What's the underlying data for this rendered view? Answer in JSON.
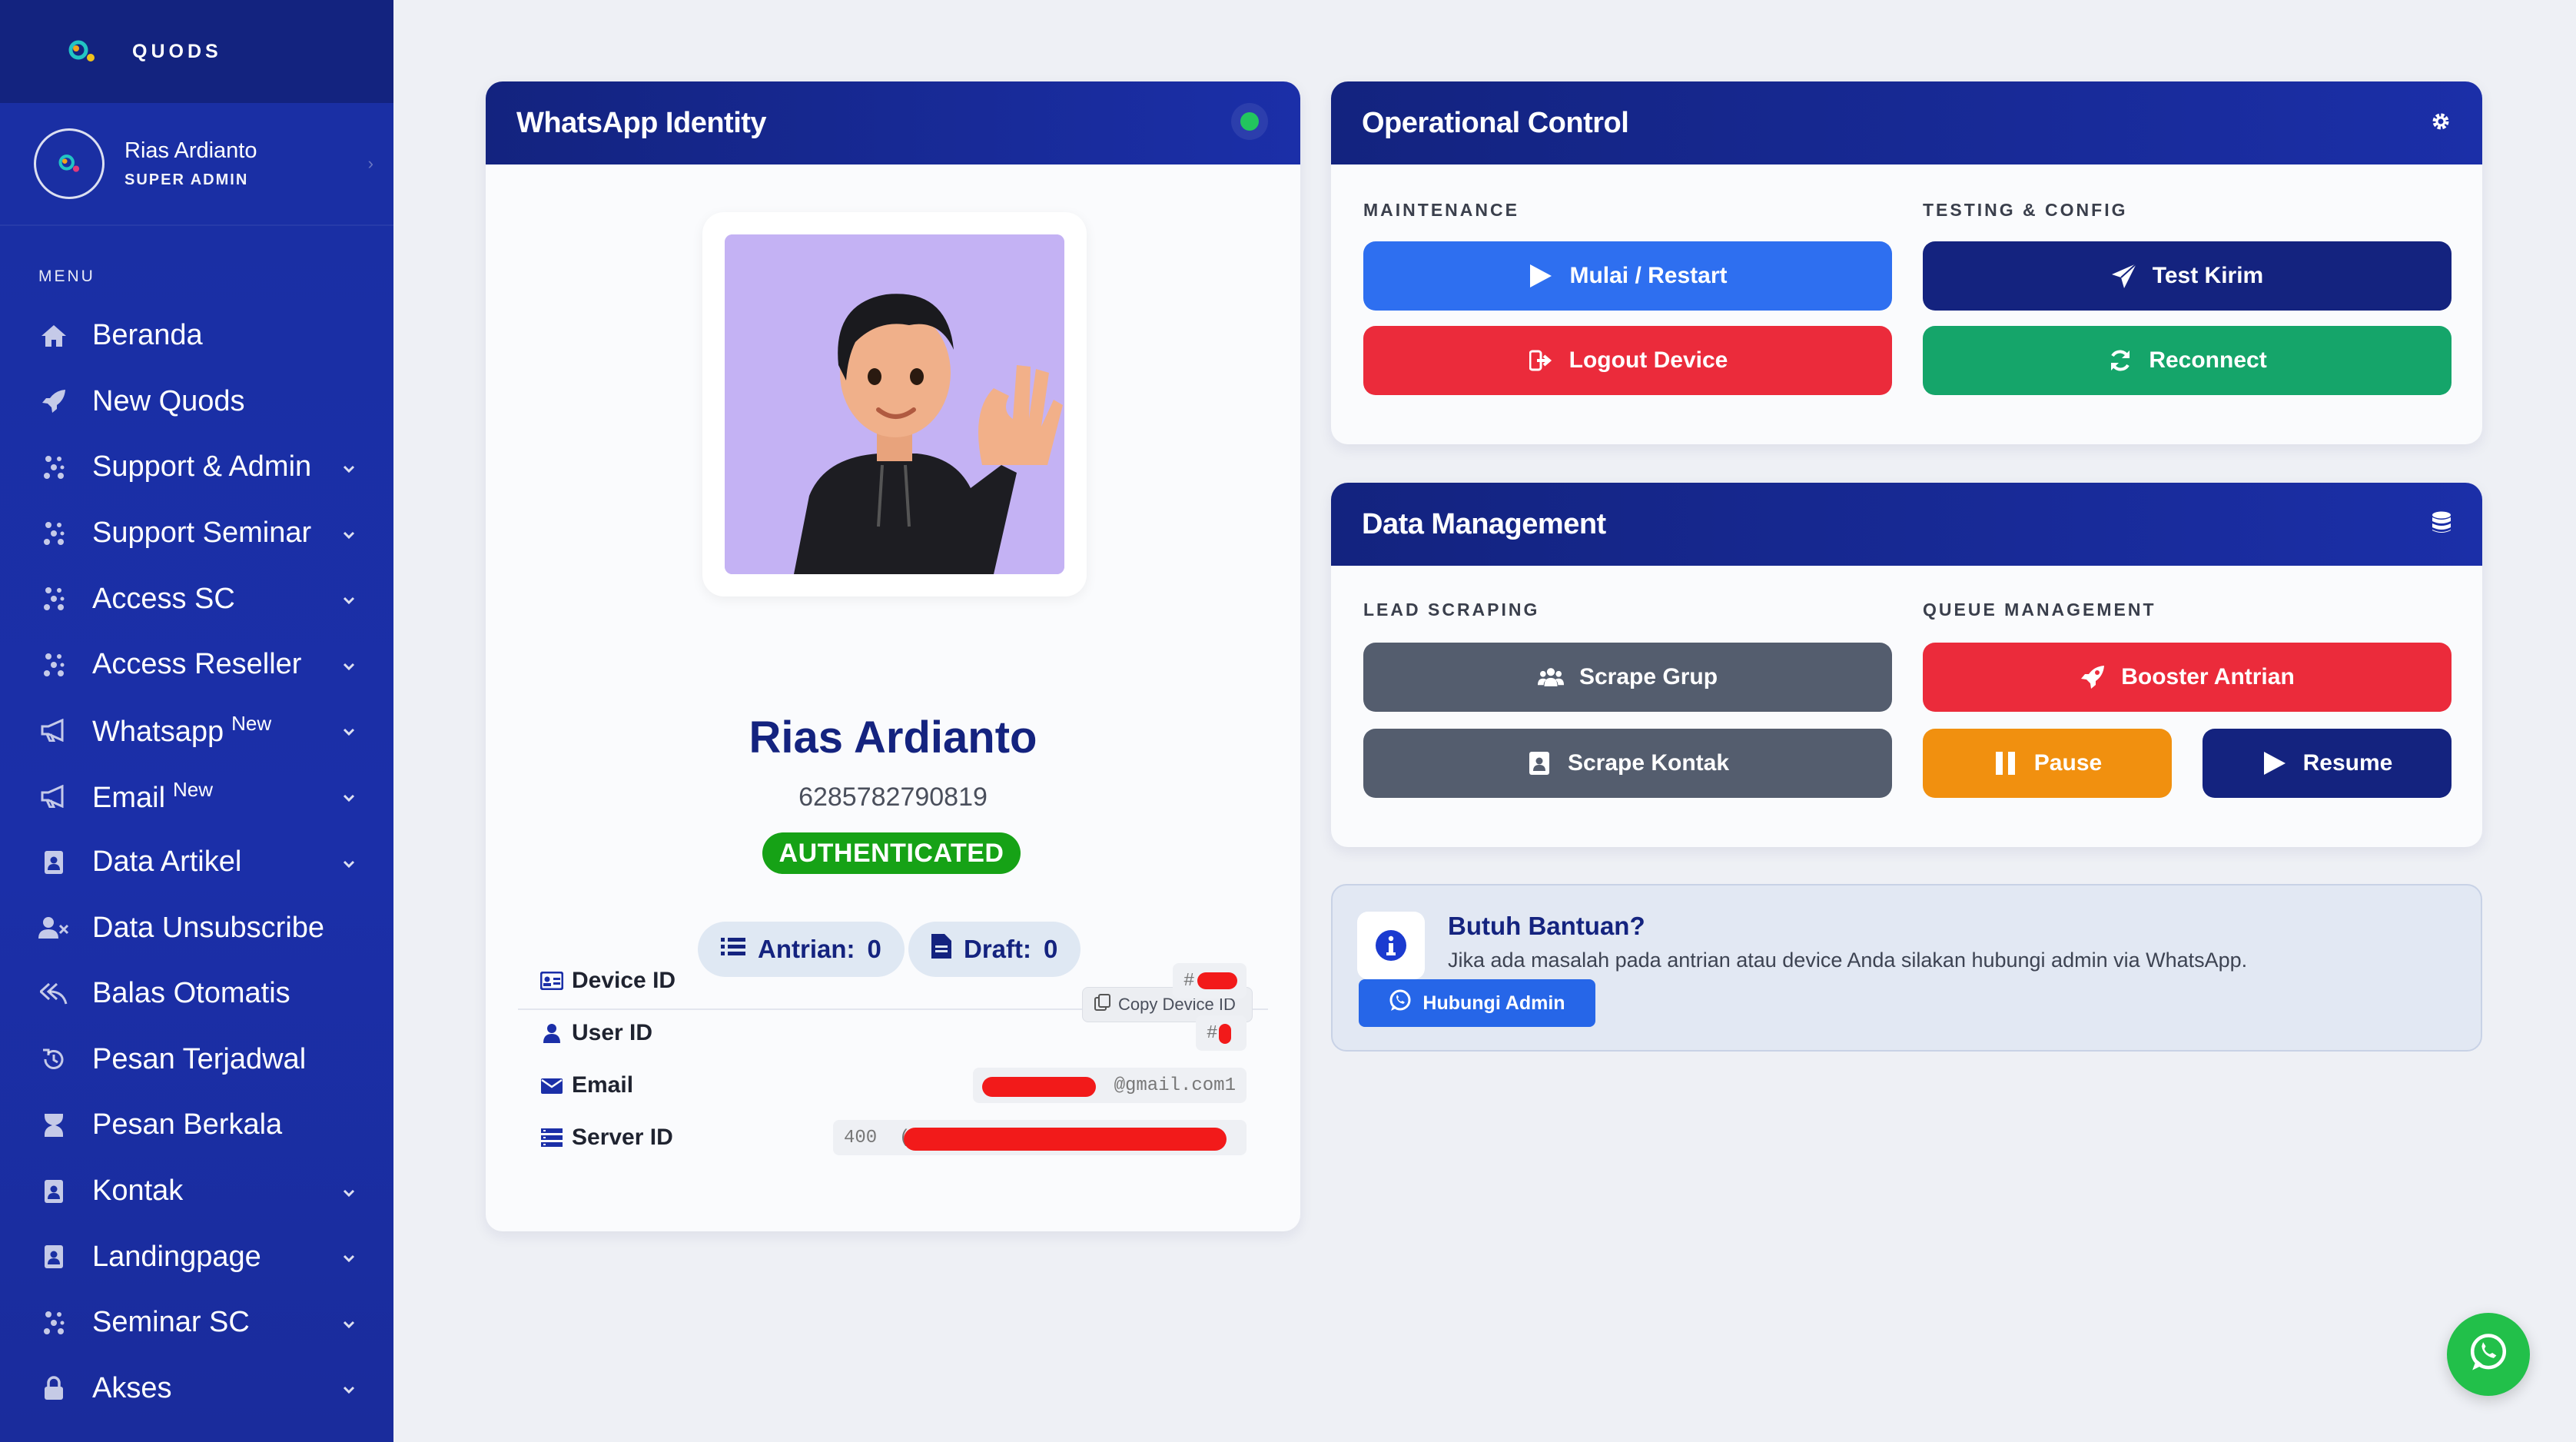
{
  "brand": {
    "name": "QUODS"
  },
  "profile": {
    "name": "Rias Ardianto",
    "role": "SUPER ADMIN"
  },
  "menu": {
    "label": "MENU",
    "items": [
      {
        "label": "Beranda",
        "icon": "home-icon",
        "badge": "",
        "has_submenu": false
      },
      {
        "label": "New Quods",
        "icon": "rocket-icon",
        "badge": "",
        "has_submenu": false
      },
      {
        "label": "Support & Admin",
        "icon": "cluster-icon",
        "badge": "",
        "has_submenu": true
      },
      {
        "label": "Support Seminar",
        "icon": "cluster-icon",
        "badge": "",
        "has_submenu": true
      },
      {
        "label": "Access SC",
        "icon": "cluster-icon",
        "badge": "",
        "has_submenu": true
      },
      {
        "label": "Access Reseller",
        "icon": "cluster-icon",
        "badge": "",
        "has_submenu": true
      },
      {
        "label": "Whatsapp",
        "icon": "megaphone-icon",
        "badge": "New",
        "has_submenu": true
      },
      {
        "label": "Email",
        "icon": "megaphone-icon",
        "badge": "New",
        "has_submenu": true
      },
      {
        "label": "Data Artikel",
        "icon": "contact-book-icon",
        "badge": "",
        "has_submenu": true
      },
      {
        "label": "Data Unsubscribe",
        "icon": "user-x-icon",
        "badge": "",
        "has_submenu": false
      },
      {
        "label": "Balas Otomatis",
        "icon": "reply-all-icon",
        "badge": "",
        "has_submenu": false
      },
      {
        "label": "Pesan Terjadwal",
        "icon": "history-icon",
        "badge": "",
        "has_submenu": false
      },
      {
        "label": "Pesan Berkala",
        "icon": "hourglass-icon",
        "badge": "",
        "has_submenu": false
      },
      {
        "label": "Kontak",
        "icon": "contact-book-icon",
        "badge": "",
        "has_submenu": true
      },
      {
        "label": "Landingpage",
        "icon": "contact-book-icon",
        "badge": "",
        "has_submenu": true
      },
      {
        "label": "Seminar SC",
        "icon": "cluster-icon",
        "badge": "",
        "has_submenu": true
      },
      {
        "label": "Akses",
        "icon": "lock-icon",
        "badge": "",
        "has_submenu": true
      }
    ]
  },
  "identity": {
    "title": "WhatsApp Identity",
    "status_color": "#22c55e",
    "name": "Rias Ardianto",
    "phone": "6285782790819",
    "status": "AUTHENTICATED",
    "antrian_label": "Antrian:",
    "antrian_value": "0",
    "draft_label": "Draft:",
    "draft_value": "0",
    "copy_label": "Copy Device ID",
    "rows": [
      {
        "label": "Device ID",
        "value": "#",
        "icon": "id-card-icon"
      },
      {
        "label": "User ID",
        "value": "#",
        "icon": "user-icon"
      },
      {
        "label": "Email",
        "value": "@gmail.com1",
        "icon": "envelope-icon"
      },
      {
        "label": "Server ID",
        "value": "400  (",
        "icon": "server-icon"
      }
    ]
  },
  "operational": {
    "title": "Operational Control",
    "maintenance_label": "MAINTENANCE",
    "testing_label": "TESTING & CONFIG",
    "buttons": {
      "restart": "Mulai / Restart",
      "logout": "Logout Device",
      "test": "Test Kirim",
      "reconnect": "Reconnect"
    }
  },
  "data_management": {
    "title": "Data Management",
    "lead_label": "LEAD SCRAPING",
    "queue_label": "QUEUE MANAGEMENT",
    "buttons": {
      "scrape_grup": "Scrape Grup",
      "scrape_kontak": "Scrape Kontak",
      "booster": "Booster Antrian",
      "pause": "Pause",
      "resume": "Resume"
    }
  },
  "help": {
    "title": "Butuh Bantuan?",
    "text": "Jika ada masalah pada antrian atau device Anda silakan hubungi admin via WhatsApp.",
    "button": "Hubungi Admin"
  },
  "colors": {
    "primary": "#1b2fa8",
    "blue": "#2e6ff0",
    "red": "#eb2b3b",
    "green": "#15a56a",
    "gray": "#545d6e",
    "orange": "#f1900f",
    "navy": "#14237f"
  }
}
